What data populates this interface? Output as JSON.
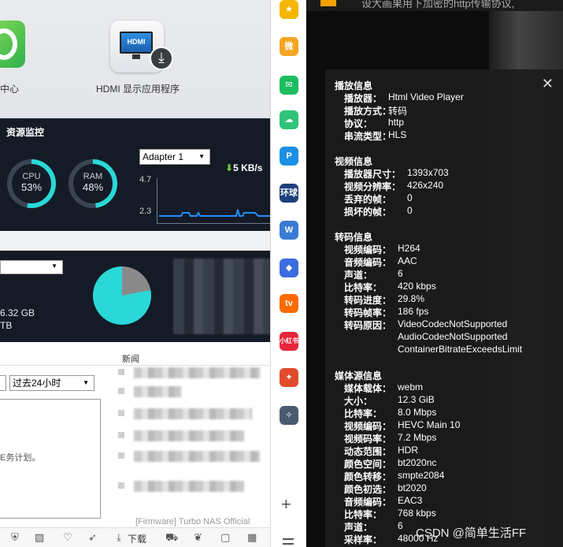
{
  "desktop": {
    "app1_label": "中心",
    "hdmi_app_label": "HDMI 显示应用程序",
    "hdmi_icon_text": "HDMI",
    "resource_monitor": {
      "title": "资源监控",
      "cpu_label": "CPU",
      "cpu_value": "53%",
      "cpu_percent": 53,
      "ram_label": "RAM",
      "ram_value": "48%",
      "ram_percent": 48,
      "adapter": "Adapter 1",
      "net_speed": "5 KB/s",
      "net_max": "4.7",
      "net_min": "2.3",
      "gauge_color": "#2ad8d8"
    },
    "storage": {
      "used": "6.32 GB",
      "total_unit": "TB",
      "pie_used_fraction": 0.22
    },
    "news_label": "新闻",
    "period": "过去24小时",
    "task_text": "E务计划。",
    "news_faint": "[Firmware] Turbo NAS Official",
    "taskbar_download": "下载"
  },
  "sidebar": {
    "items": [
      {
        "name": "favorites-star-icon",
        "glyph": "★",
        "color": "#f6b500"
      },
      {
        "name": "weibo-icon",
        "glyph": "微",
        "color": "#f5a623"
      },
      {
        "name": "mail-icon",
        "glyph": "✉",
        "color": "#1bbd5f"
      },
      {
        "name": "cloud-icon",
        "glyph": "☁",
        "color": "#2ec47a"
      },
      {
        "name": "p-app-icon",
        "glyph": "P",
        "color": "#1b8fe6"
      },
      {
        "name": "news-app-icon",
        "glyph": "环球",
        "color": "#1d3f7a"
      },
      {
        "name": "doc-icon",
        "glyph": "W",
        "color": "#3a7bd5"
      },
      {
        "name": "game-icon-1",
        "glyph": "◆",
        "color": "#3c6de0"
      },
      {
        "name": "video-app-icon",
        "glyph": "tv",
        "color": "#ff6a00"
      },
      {
        "name": "redbook-icon",
        "glyph": "小红书",
        "color": "#e8263a"
      },
      {
        "name": "game-icon-2",
        "glyph": "✦",
        "color": "#e04b2c"
      },
      {
        "name": "game-icon-3",
        "glyph": "✧",
        "color": "#4a5a70"
      }
    ],
    "add_glyph": "+"
  },
  "player": {
    "topbar_text": "设大画果用下加密的http传输协议,",
    "close_glyph": "✕",
    "sections": [
      {
        "title": "播放信息",
        "rows": [
          {
            "k": "播放器：",
            "v": "Html Video Player"
          },
          {
            "k": "播放方式：",
            "v": "转码"
          },
          {
            "k": "协议：",
            "v": "http"
          },
          {
            "k": "串流类型：",
            "v": "HLS"
          }
        ]
      },
      {
        "title": "视频信息",
        "rows": [
          {
            "k": "播放器尺寸：",
            "v": "1393x703"
          },
          {
            "k": "视频分辨率：",
            "v": "426x240"
          },
          {
            "k": "丢弃的帧：",
            "v": "0"
          },
          {
            "k": "损坏的帧：",
            "v": "0"
          }
        ]
      },
      {
        "title": "转码信息",
        "rows": [
          {
            "k": "视频编码：",
            "v": "H264"
          },
          {
            "k": "音频编码：",
            "v": "AAC"
          },
          {
            "k": "声道：",
            "v": "6"
          },
          {
            "k": "比特率：",
            "v": "420 kbps"
          },
          {
            "k": "转码进度：",
            "v": "29.8%"
          },
          {
            "k": "转码帧率：",
            "v": "186 fps"
          },
          {
            "k": "转码原因：",
            "v": "VideoCodecNotSupported"
          },
          {
            "k": "",
            "v": "AudioCodecNotSupported"
          },
          {
            "k": "",
            "v": "ContainerBitrateExceedsLimit"
          }
        ]
      },
      {
        "title": "媒体源信息",
        "rows": [
          {
            "k": "媒体载体：",
            "v": "webm"
          },
          {
            "k": "大小：",
            "v": "12.3 GiB"
          },
          {
            "k": "比特率：",
            "v": "8.0 Mbps"
          },
          {
            "k": "视频编码：",
            "v": "HEVC Main 10"
          },
          {
            "k": "视频码率：",
            "v": "7.2 Mbps"
          },
          {
            "k": "动态范围：",
            "v": "HDR"
          },
          {
            "k": "颜色空间：",
            "v": "bt2020nc"
          },
          {
            "k": "颜色转移：",
            "v": "smpte2084"
          },
          {
            "k": "颜色初选：",
            "v": "bt2020"
          },
          {
            "k": "音频编码：",
            "v": "EAC3"
          },
          {
            "k": "比特率：",
            "v": "768 kbps"
          },
          {
            "k": "声道：",
            "v": "6"
          },
          {
            "k": "采样率：",
            "v": "48000 Hz"
          }
        ]
      }
    ]
  },
  "watermark": "CSDN @简单生活FF"
}
